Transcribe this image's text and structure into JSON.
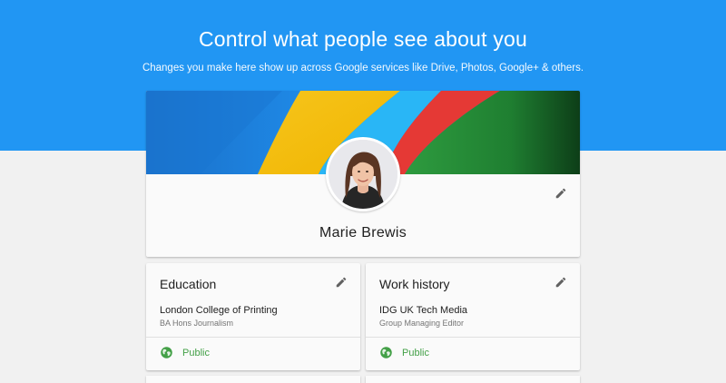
{
  "header": {
    "title": "Control what people see about you",
    "subtitle": "Changes you make here show up across Google services like Drive, Photos, Google+ & others."
  },
  "profile": {
    "name": "Marie Brewis",
    "edit_icon": "pencil-icon",
    "avatar": "profile-photo"
  },
  "cards": [
    {
      "heading": "Education",
      "primary": "London College of Printing",
      "secondary": "BA Hons Journalism",
      "visibility": "Public",
      "visibility_icon": "globe-icon"
    },
    {
      "heading": "Work history",
      "primary": "IDG UK Tech Media",
      "secondary": "Group Managing Editor",
      "visibility": "Public",
      "visibility_icon": "globe-icon"
    }
  ],
  "colors": {
    "header_blue": "#2196f3",
    "page_background": "#f1f1f1",
    "public_green": "#43a047",
    "icon_grey": "#616161"
  }
}
